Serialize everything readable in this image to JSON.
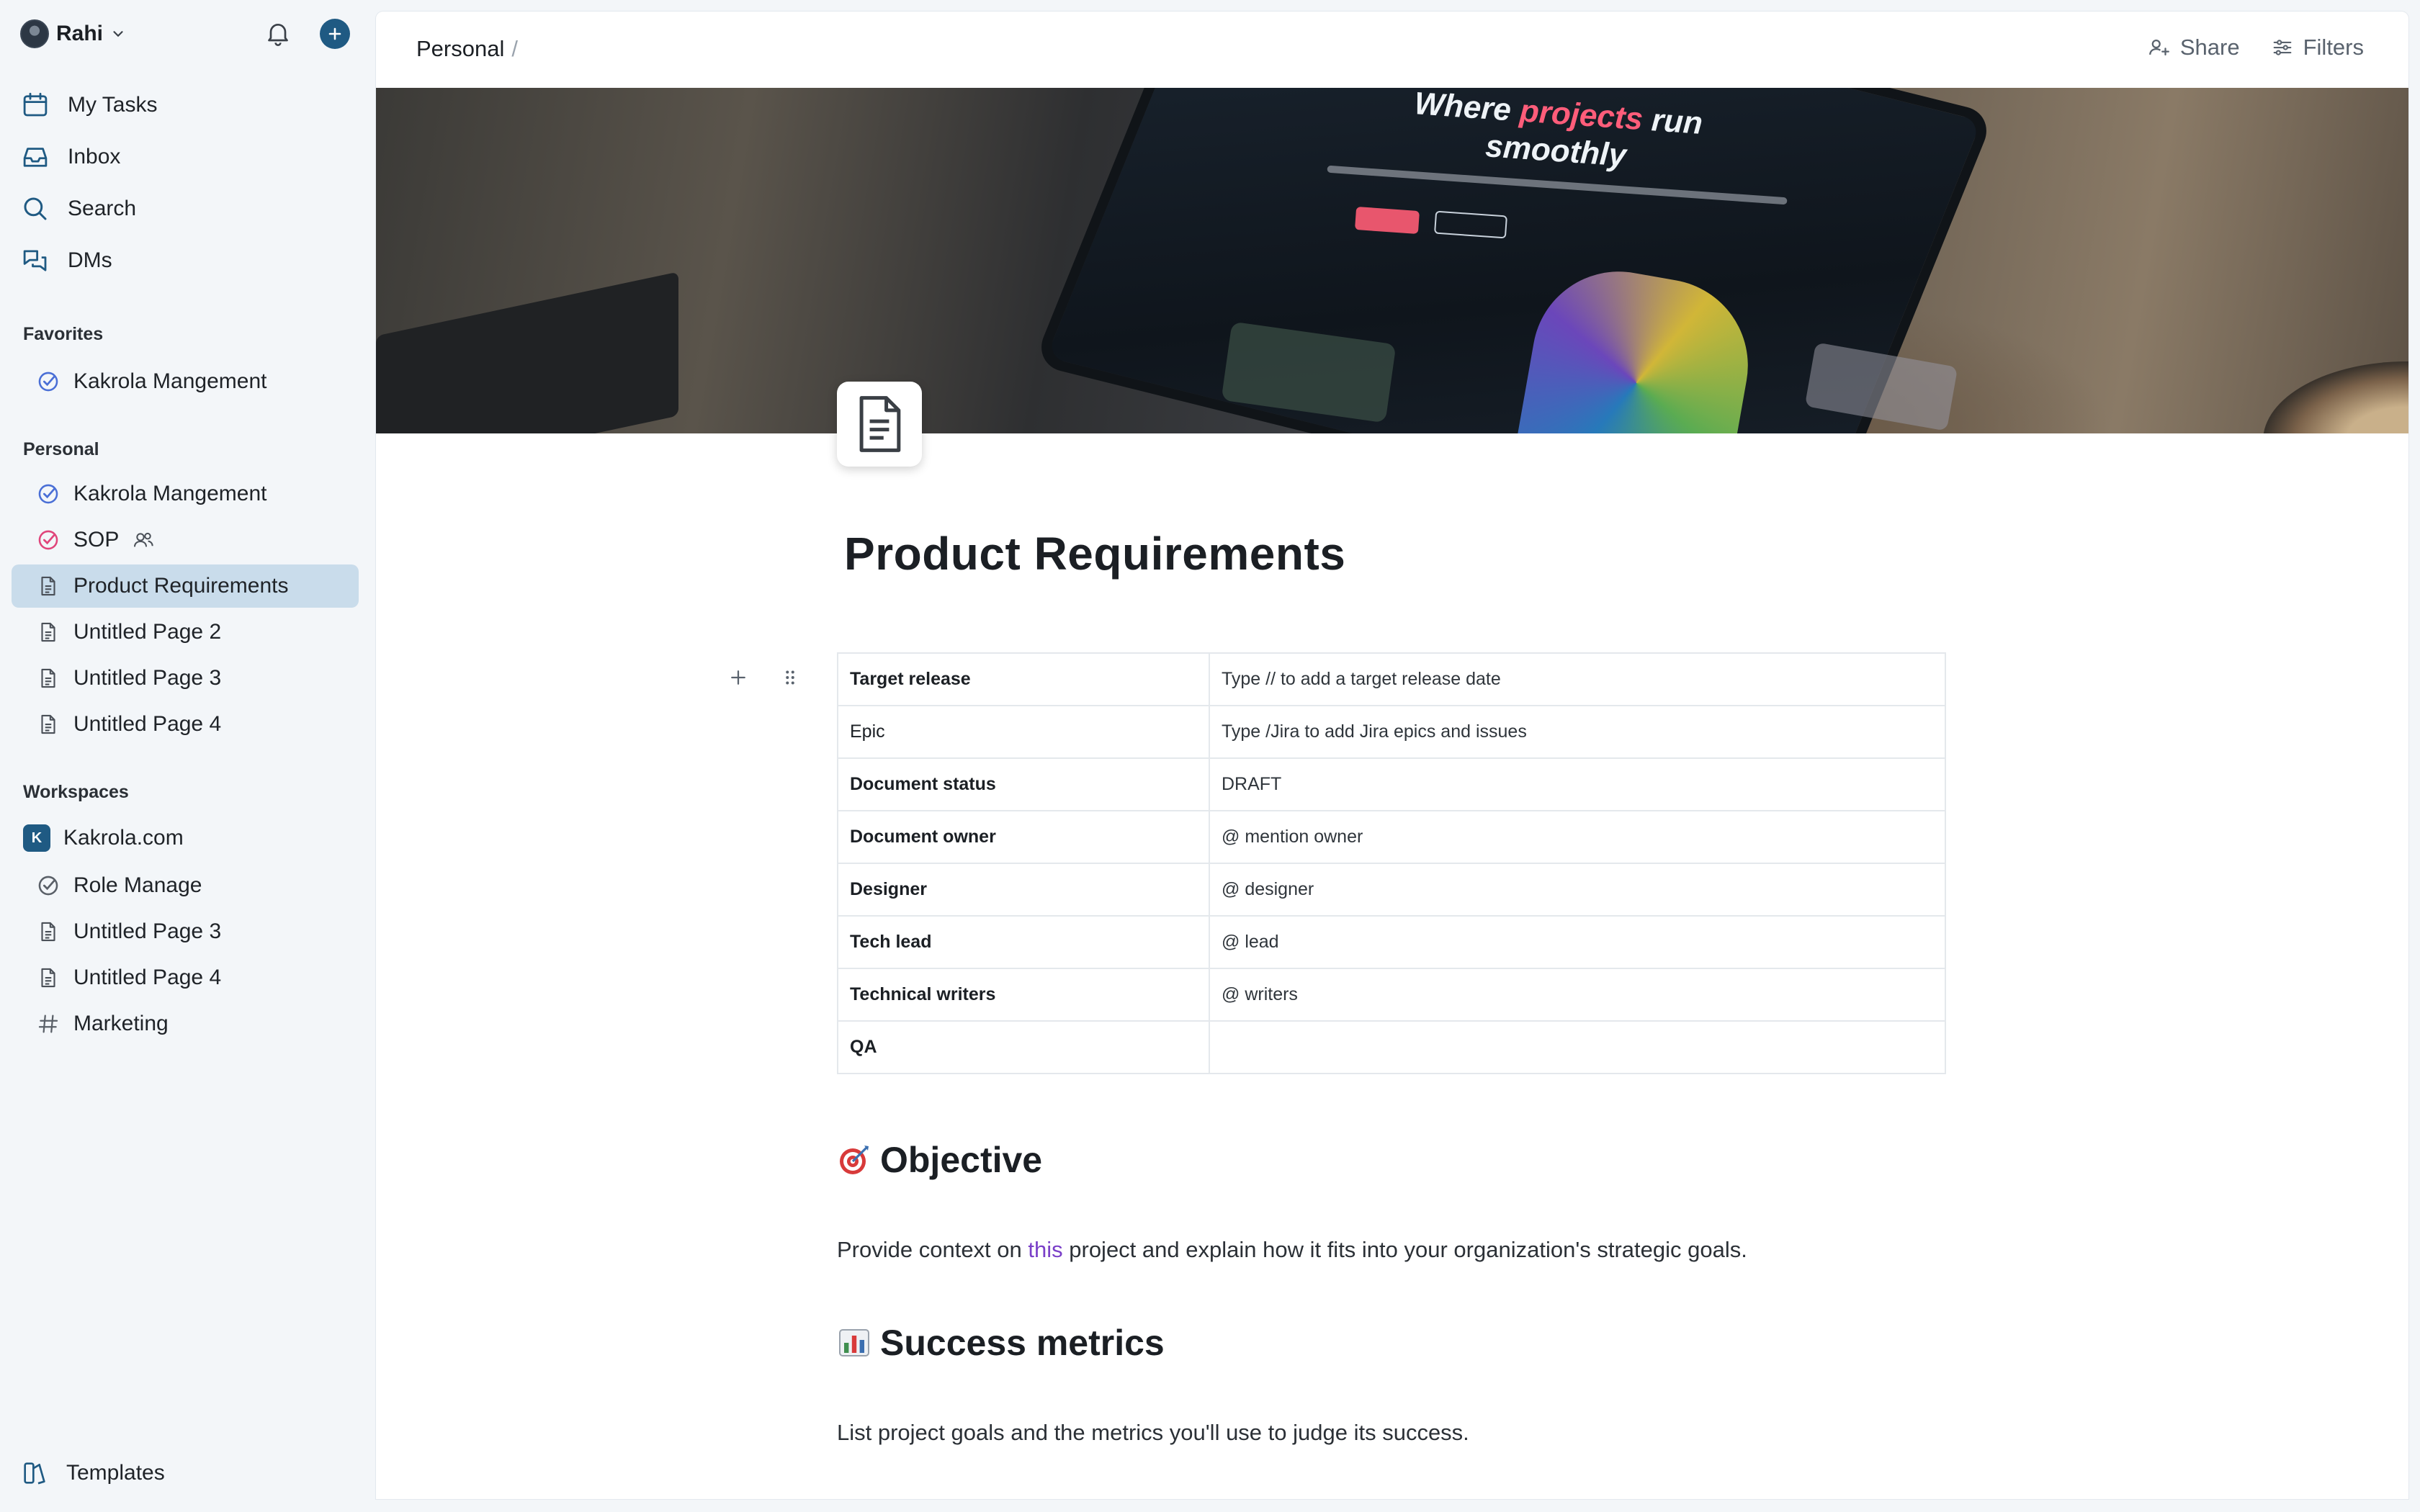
{
  "sidebar": {
    "user": {
      "name": "Rahi"
    },
    "nav": [
      {
        "label": "My Tasks",
        "icon": "calendar-icon"
      },
      {
        "label": "Inbox",
        "icon": "inbox-icon"
      },
      {
        "label": "Search",
        "icon": "search-icon"
      },
      {
        "label": "DMs",
        "icon": "chat-icon"
      }
    ],
    "favorites": {
      "label": "Favorites",
      "items": [
        {
          "label": "Kakrola Mangement",
          "icon": "check-circle-icon"
        }
      ]
    },
    "personal": {
      "label": "Personal",
      "items": [
        {
          "label": "Kakrola Mangement",
          "icon": "check-circle-icon"
        },
        {
          "label": "SOP",
          "icon": "check-circle-icon"
        },
        {
          "label": "Product Requirements",
          "icon": "document-icon"
        },
        {
          "label": "Untitled Page 2",
          "icon": "document-icon"
        },
        {
          "label": "Untitled Page 3",
          "icon": "document-icon"
        },
        {
          "label": "Untitled Page 4",
          "icon": "document-icon"
        }
      ]
    },
    "workspaces": {
      "label": "Workspaces",
      "workspace": {
        "badge": "K",
        "name": "Kakrola.com"
      },
      "items": [
        {
          "label": "Role Manage",
          "icon": "check-circle-icon"
        },
        {
          "label": "Untitled Page 3",
          "icon": "document-icon"
        },
        {
          "label": "Untitled Page 4",
          "icon": "document-icon"
        },
        {
          "label": "Marketing",
          "icon": "hash-icon"
        }
      ]
    },
    "templates": {
      "label": "Templates"
    }
  },
  "topbar": {
    "breadcrumb": "Personal",
    "separator": "/",
    "share_label": "Share",
    "filters_label": "Filters"
  },
  "cover": {
    "headline_1": "Where",
    "headline_accent": "projects",
    "headline_2": "run",
    "headline_3": "smoothly"
  },
  "document": {
    "title": "Product Requirements",
    "properties": [
      {
        "key": "Target release",
        "value": "Type // to add a target release date"
      },
      {
        "key": "Epic",
        "value": "Type /Jira to add Jira epics and issues"
      },
      {
        "key": "Document status",
        "value": "DRAFT"
      },
      {
        "key": "Document owner",
        "value": "@ mention owner"
      },
      {
        "key": "Designer",
        "value": "@ designer"
      },
      {
        "key": "Tech lead",
        "value": "@ lead"
      },
      {
        "key": "Technical writers",
        "value": "@ writers"
      },
      {
        "key": "QA",
        "value": ""
      }
    ],
    "objective": {
      "heading": "Objective",
      "text_before": "Provide context on ",
      "link": "this",
      "text_after": " project and explain how it fits into your organization's strategic goals."
    },
    "success": {
      "heading": "Success metrics",
      "text": "List project goals and the metrics you'll use to judge its success."
    }
  },
  "colors": {
    "accent": "#1f5a83",
    "active_item": "#c9dceb",
    "check_blue": "#4a6fd6",
    "check_pink": "#e0457b",
    "link_purple": "#7a3fc8"
  }
}
